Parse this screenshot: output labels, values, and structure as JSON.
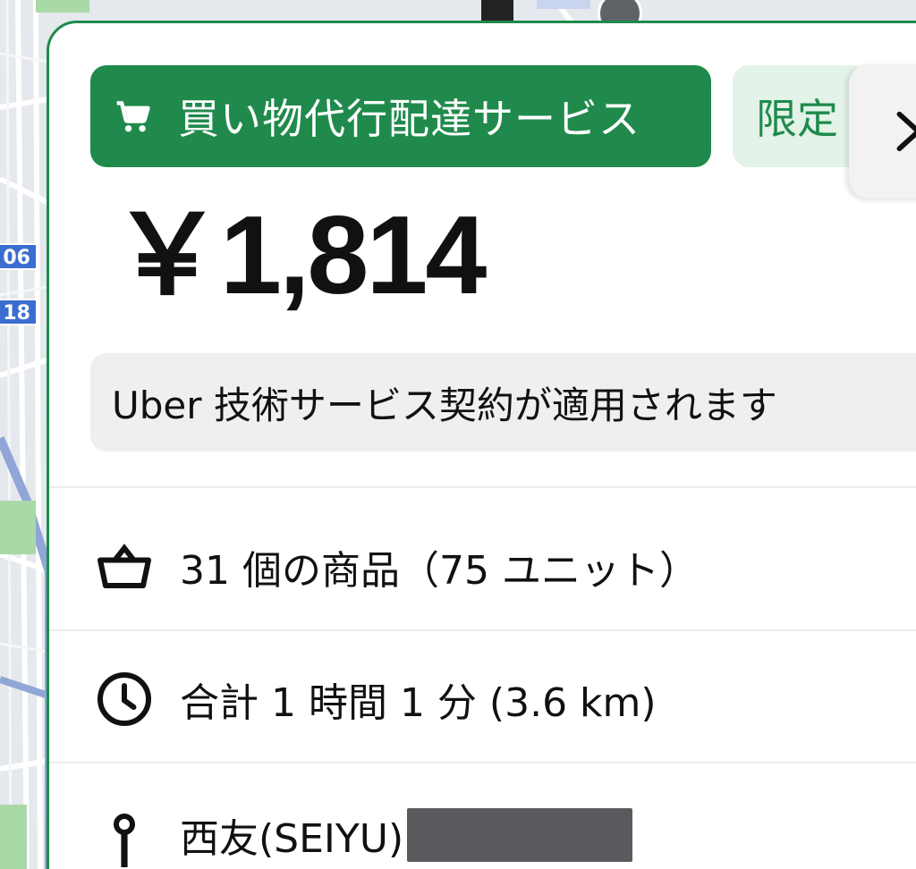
{
  "map": {
    "route_badges": [
      "06",
      "18"
    ]
  },
  "card": {
    "service_label": "買い物代行配達サービス",
    "limited_label": "限定",
    "next_glyph": "›",
    "price": "￥1,814",
    "terms": "Uber 技術サービス契約が適用されます",
    "items": "31 個の商品（75 ユニット）",
    "duration": "合計 1 時間 1 分 (3.6 km)",
    "pickup": "西友(SEIYU)"
  },
  "colors": {
    "accent_green": "#1f8a4c",
    "limited_bg": "#e3f3e8",
    "terms_bg": "#efefef"
  },
  "icons": {
    "service": "cart-icon",
    "items": "basket-icon",
    "duration": "clock-icon",
    "pickup": "location-pin-icon",
    "next": "chevron-right-icon"
  }
}
